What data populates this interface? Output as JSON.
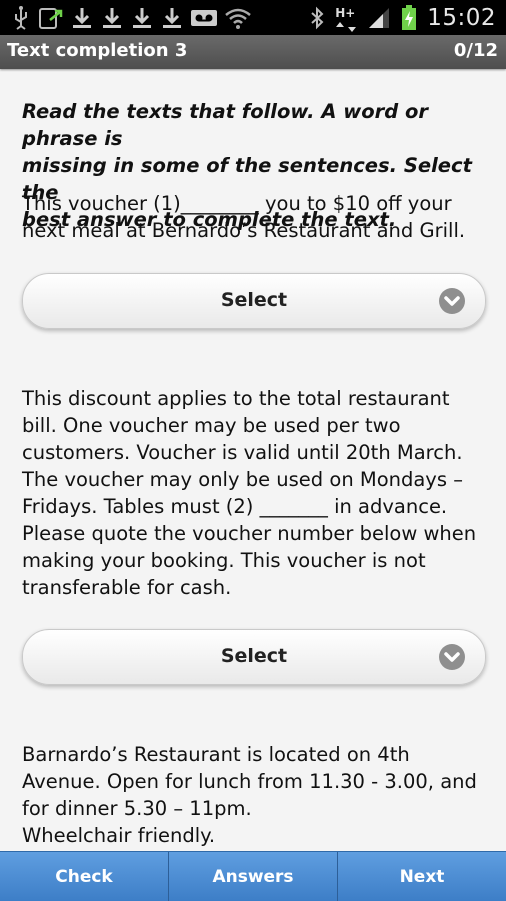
{
  "status_bar": {
    "time": "15:02",
    "network_label": "H+",
    "icons": [
      "usb-icon",
      "screen-share-icon",
      "download-icon",
      "download-icon",
      "download-icon",
      "download-icon",
      "voicemail-icon",
      "wifi-icon",
      "bluetooth-icon",
      "signal-icon",
      "battery-icon"
    ]
  },
  "header": {
    "title": "Text completion 3",
    "counter": "0/12"
  },
  "instructions": "Read the texts that follow. A word or phrase is missing in some of the sentences. Select the best answer to complete the text.",
  "instruction_lines": [
    "Read the texts that follow. A word or phrase is",
    "missing in some of the sentences. Select the",
    "best answer to complete the text."
  ],
  "passage1_lines": [
    "This voucher (1)________ you to $10 off your",
    "next meal at Bernardo’s Restaurant and Grill."
  ],
  "select1": {
    "label": "Select"
  },
  "passage2_lines": [
    "This discount applies to the total restaurant",
    "bill. One voucher may be used per two",
    "customers. Voucher is valid until 20th March.",
    "The voucher may only be used on Mondays –",
    "Fridays. Tables must (2) _______ in advance.",
    "Please quote the voucher number below when",
    "making your booking. This voucher is not",
    "transferable for cash."
  ],
  "select2": {
    "label": "Select"
  },
  "passage3_lines": [
    "Barnardo’s Restaurant is located on 4th",
    "Avenue. Open for lunch from 11.30 - 3.00, and",
    "for dinner 5.30 – 11pm.",
    "Wheelchair friendly."
  ],
  "footer": {
    "check_label": "Check",
    "answers_label": "Answers",
    "next_label": "Next"
  },
  "colors": {
    "footer_blue": "#4a8ad2",
    "title_bar": "#5a5a5a"
  }
}
